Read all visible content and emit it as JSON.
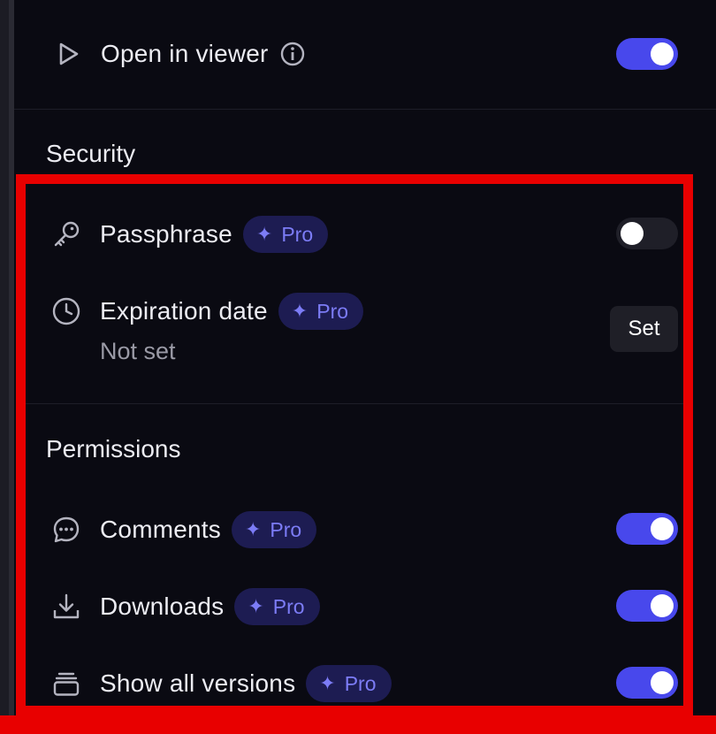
{
  "viewer": {
    "label": "Open in viewer",
    "enabled": true
  },
  "security": {
    "title": "Security",
    "passphrase": {
      "label": "Passphrase",
      "badge": "Pro",
      "enabled": false
    },
    "expiration": {
      "label": "Expiration date",
      "badge": "Pro",
      "value": "Not set",
      "action": "Set"
    }
  },
  "permissions": {
    "title": "Permissions",
    "items": [
      {
        "label": "Comments",
        "badge": "Pro",
        "enabled": true
      },
      {
        "label": "Downloads",
        "badge": "Pro",
        "enabled": true
      },
      {
        "label": "Show all versions",
        "badge": "Pro",
        "enabled": true
      }
    ]
  },
  "icons": {
    "viewer": "play-icon",
    "info": "info-icon",
    "passphrase": "key-icon",
    "expiration": "clock-icon",
    "comments": "comment-icon",
    "downloads": "download-icon",
    "versions": "layers-icon",
    "badge": "sparkle-icon"
  },
  "colors": {
    "accent": "#4848ec",
    "badge_bg": "#1d1c52",
    "badge_text": "#7c7cf6",
    "highlight": "#e80000"
  }
}
